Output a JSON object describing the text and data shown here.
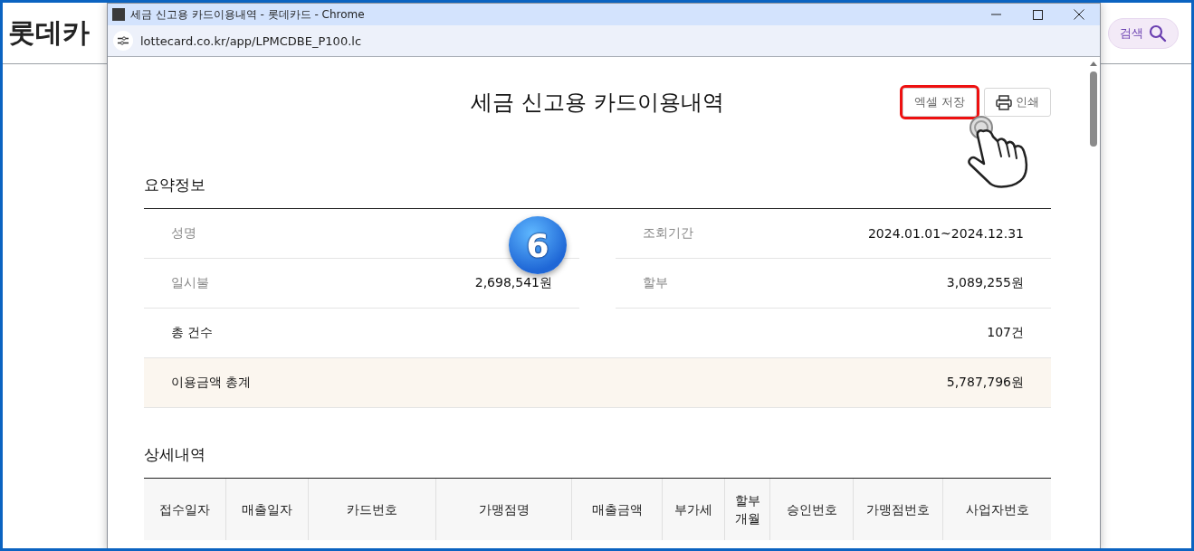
{
  "background_page": {
    "logo": "롯데카",
    "search_button": "검색"
  },
  "popup": {
    "title": "세금 신고용 카드이용내역 - 롯데카드 - Chrome",
    "url": "lottecard.co.kr/app/LPMCDBE_P100.lc",
    "heading": "세금 신고용 카드이용내역",
    "buttons": [
      {
        "kind": "text",
        "label": "엑셀 저장",
        "highlighted": true
      },
      {
        "kind": "print",
        "label": "인쇄",
        "highlighted": false
      }
    ],
    "step_badge": "6",
    "summary": {
      "title": "요약정보",
      "rows": [
        {
          "kind": "pair",
          "items": [
            {
              "label": "성명"
            },
            {
              "label": "조회기간",
              "value": "2024.01.01~2024.12.31"
            }
          ]
        },
        {
          "kind": "pair",
          "items": [
            {
              "label": "일시불",
              "value": "2,698,541원"
            },
            {
              "label": "할부",
              "value": "3,089,255원"
            }
          ]
        },
        {
          "kind": "total",
          "label": "총 건수",
          "value": "107건",
          "highlighted": false
        },
        {
          "kind": "total",
          "label": "이용금액 총계",
          "value": "5,787,796원",
          "highlighted": true
        }
      ]
    },
    "details": {
      "title": "상세내역",
      "columns": [
        "접수일자",
        "매출일자",
        "카드번호",
        "가맹점명",
        "매출금액",
        "부가세",
        "할부\n개월",
        "승인번호",
        "가맹점번호",
        "사업자번호"
      ]
    }
  }
}
